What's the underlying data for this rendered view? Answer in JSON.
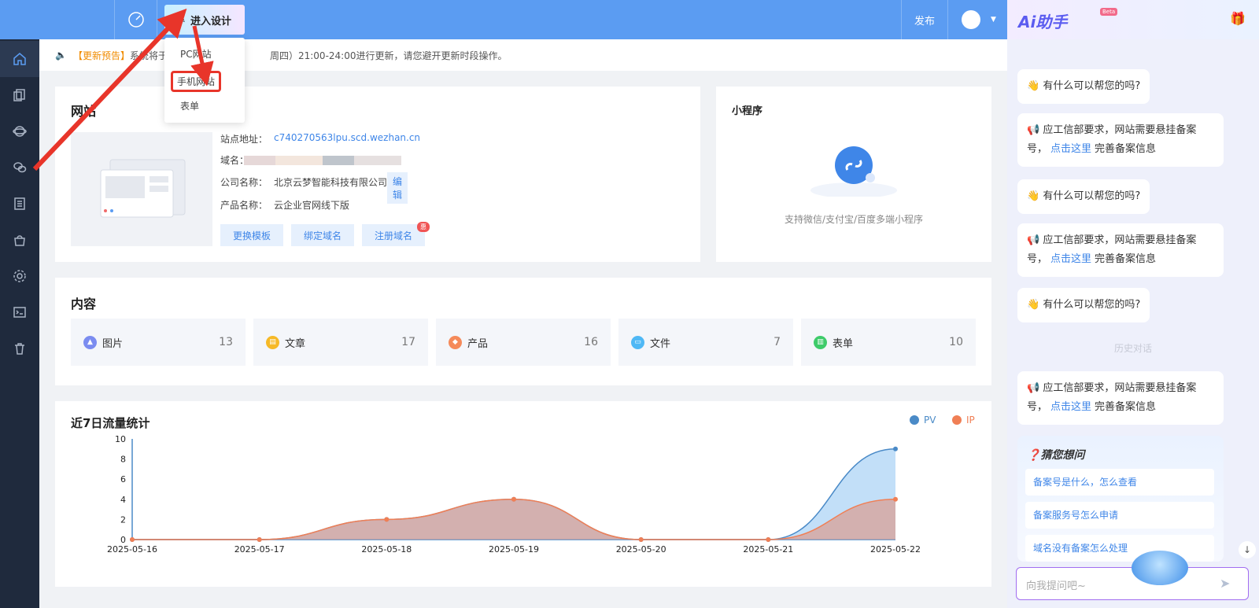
{
  "topbar": {
    "design_label": "进入设计",
    "publish_label": "发布"
  },
  "notice": {
    "tag": "【更新预告】",
    "text_left": "系统将于",
    "text_right": "周四）21:00-24:00进行更新，请您避开更新时段操作。"
  },
  "dropdown": {
    "items": [
      "PC网站",
      "手机网站",
      "表单"
    ]
  },
  "website": {
    "title": "网站",
    "site_label": "站点地址：",
    "site_value": "c740270563lpu.scd.wezhan.cn",
    "domain_label": "域名：",
    "company_label": "公司名称：",
    "company_value": "北京云梦智能科技有限公司",
    "edit_label": "编辑",
    "product_label": "产品名称：",
    "product_value": "云企业官网线下版",
    "btn_template": "更换模板",
    "btn_bind": "绑定域名",
    "btn_register": "注册域名",
    "register_badge": "惠"
  },
  "miniprogram": {
    "title": "小程序",
    "desc": "支持微信/支付宝/百度多端小程序"
  },
  "content": {
    "title": "内容",
    "items": [
      {
        "label": "图片",
        "count": "13",
        "color": "#7b8cf0"
      },
      {
        "label": "文章",
        "count": "17",
        "color": "#f6b927"
      },
      {
        "label": "产品",
        "count": "16",
        "color": "#f58a5a"
      },
      {
        "label": "文件",
        "count": "7",
        "color": "#4fb8f5"
      },
      {
        "label": "表单",
        "count": "10",
        "color": "#3ecb6a"
      }
    ]
  },
  "traffic": {
    "title": "近7日流量统计",
    "legend": [
      {
        "label": "PV",
        "color": "#4a8ac7"
      },
      {
        "label": "IP",
        "color": "#f07f55"
      }
    ]
  },
  "chart_data": {
    "type": "area",
    "x": [
      "2025-05-16",
      "2025-05-17",
      "2025-05-18",
      "2025-05-19",
      "2025-05-20",
      "2025-05-21",
      "2025-05-22"
    ],
    "series": [
      {
        "name": "PV",
        "values": [
          0,
          0,
          2,
          4,
          0,
          0,
          9
        ],
        "color": "#4a8ac7"
      },
      {
        "name": "IP",
        "values": [
          0,
          0,
          2,
          4,
          0,
          0,
          4
        ],
        "color": "#f07f55"
      }
    ],
    "yticks": [
      "0",
      "2",
      "4",
      "6",
      "8",
      "10"
    ],
    "ylim": [
      0,
      10
    ],
    "legend_position": "top-right"
  },
  "ai": {
    "title": "Ai助手",
    "beta": "Beta",
    "help_q": "有什么可以帮您的吗?",
    "icp_text_1": "应工信部要求，网站需要悬挂备案号，",
    "icp_link": "点击这里",
    "icp_text_2": "完善备案信息",
    "history": "历史对话",
    "guess_title": "猜您想问",
    "guess": [
      "备案号是什么，怎么查看",
      "备案服务号怎么申请",
      "域名没有备案怎么处理"
    ],
    "input_placeholder": "向我提问吧~"
  }
}
